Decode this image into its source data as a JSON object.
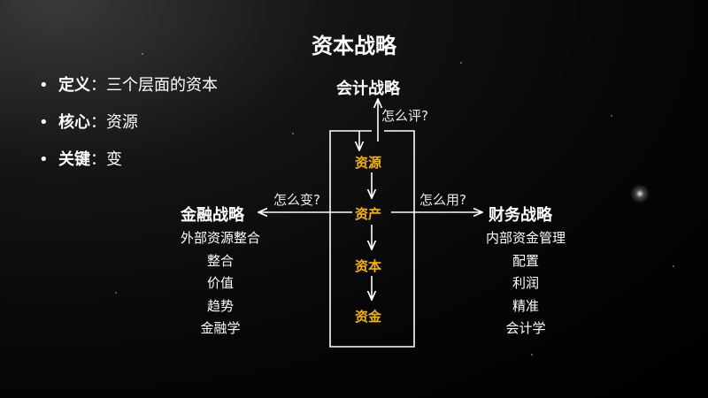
{
  "title": "资本战略",
  "bullets": [
    {
      "term": "定义",
      "sep": "：",
      "desc": "三个层面的资本"
    },
    {
      "term": "核心",
      "sep": "：",
      "desc": "资源"
    },
    {
      "term": "关键",
      "sep": "：",
      "desc": "变"
    }
  ],
  "top_node": "会计战略",
  "top_question": "怎么评?",
  "center_nodes": [
    "资源",
    "资产",
    "资本",
    "资金"
  ],
  "left": {
    "node": "金融战略",
    "question": "怎么变?",
    "items": [
      "外部资源整合",
      "整合",
      "价值",
      "趋势",
      "金融学"
    ]
  },
  "right": {
    "node": "财务战略",
    "question": "怎么用?",
    "items": [
      "内部资金管理",
      "配置",
      "利润",
      "精准",
      "会计学"
    ]
  },
  "colors": {
    "accent": "#f5b400",
    "text": "#ffffff",
    "background": "#000000"
  }
}
